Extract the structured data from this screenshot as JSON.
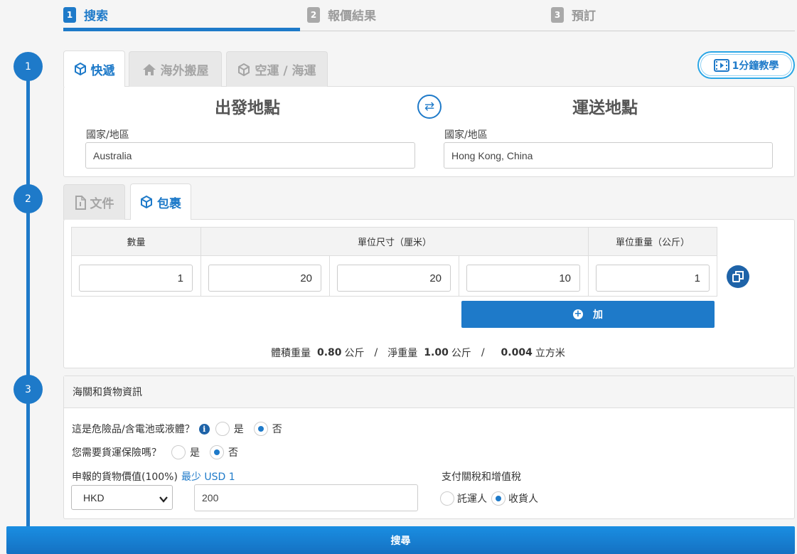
{
  "steps": [
    {
      "num": "1",
      "label": "搜索"
    },
    {
      "num": "2",
      "label": "報價結果"
    },
    {
      "num": "3",
      "label": "預訂"
    }
  ],
  "section_numbers": [
    "1",
    "2",
    "3"
  ],
  "shipment_tabs": [
    {
      "label": "快遞",
      "icon": "box-icon"
    },
    {
      "label": "海外搬屋",
      "icon": "home-icon"
    },
    {
      "label": "空運 / 海運",
      "icon": "box-icon"
    }
  ],
  "video_button": {
    "label": "1分鐘教學",
    "icon": "film-icon"
  },
  "origin": {
    "title": "出發地點",
    "field_label": "國家/地區",
    "value": "Australia"
  },
  "destination": {
    "title": "運送地點",
    "field_label": "國家/地區",
    "value": "Hong Kong, China"
  },
  "package_tabs": [
    {
      "label": "文件",
      "icon": "document-icon"
    },
    {
      "label": "包裹",
      "icon": "box-icon"
    }
  ],
  "table": {
    "headers": {
      "quantity": "數量",
      "dimensions": "單位尺寸（厘米）",
      "weight": "單位重量（公斤）"
    },
    "row": {
      "quantity": "1",
      "length": "20",
      "width": "20",
      "height": "10",
      "weight": "1"
    }
  },
  "add_button": {
    "label": "加"
  },
  "summary": {
    "volumetric_label": "體積重量",
    "volumetric_value": "0.80",
    "volumetric_unit": "公斤",
    "net_label": "淨重量",
    "net_value": "1.00",
    "net_unit": "公斤",
    "volume_value": "0.004",
    "volume_unit": "立方米",
    "separator": "/"
  },
  "customs": {
    "header": "海關和貨物資訊",
    "dangerous_q": "這是危險品/含電池或液體？",
    "insurance_q": "您需要貨運保險嗎？",
    "yes": "是",
    "no": "否",
    "declared_label": "申報的貨物價值(100%)",
    "min_label": "最少 USD 1",
    "currency": "HKD",
    "declared_value": "200",
    "duty_label": "支付關稅和增值稅",
    "shipper": "託運人",
    "consignee": "收貨人"
  },
  "search_button": {
    "label": "搜尋"
  },
  "colors": {
    "primary": "#1e7ac9",
    "accent_light": "#2aa6e6",
    "dark_blue": "#1e63a8"
  }
}
